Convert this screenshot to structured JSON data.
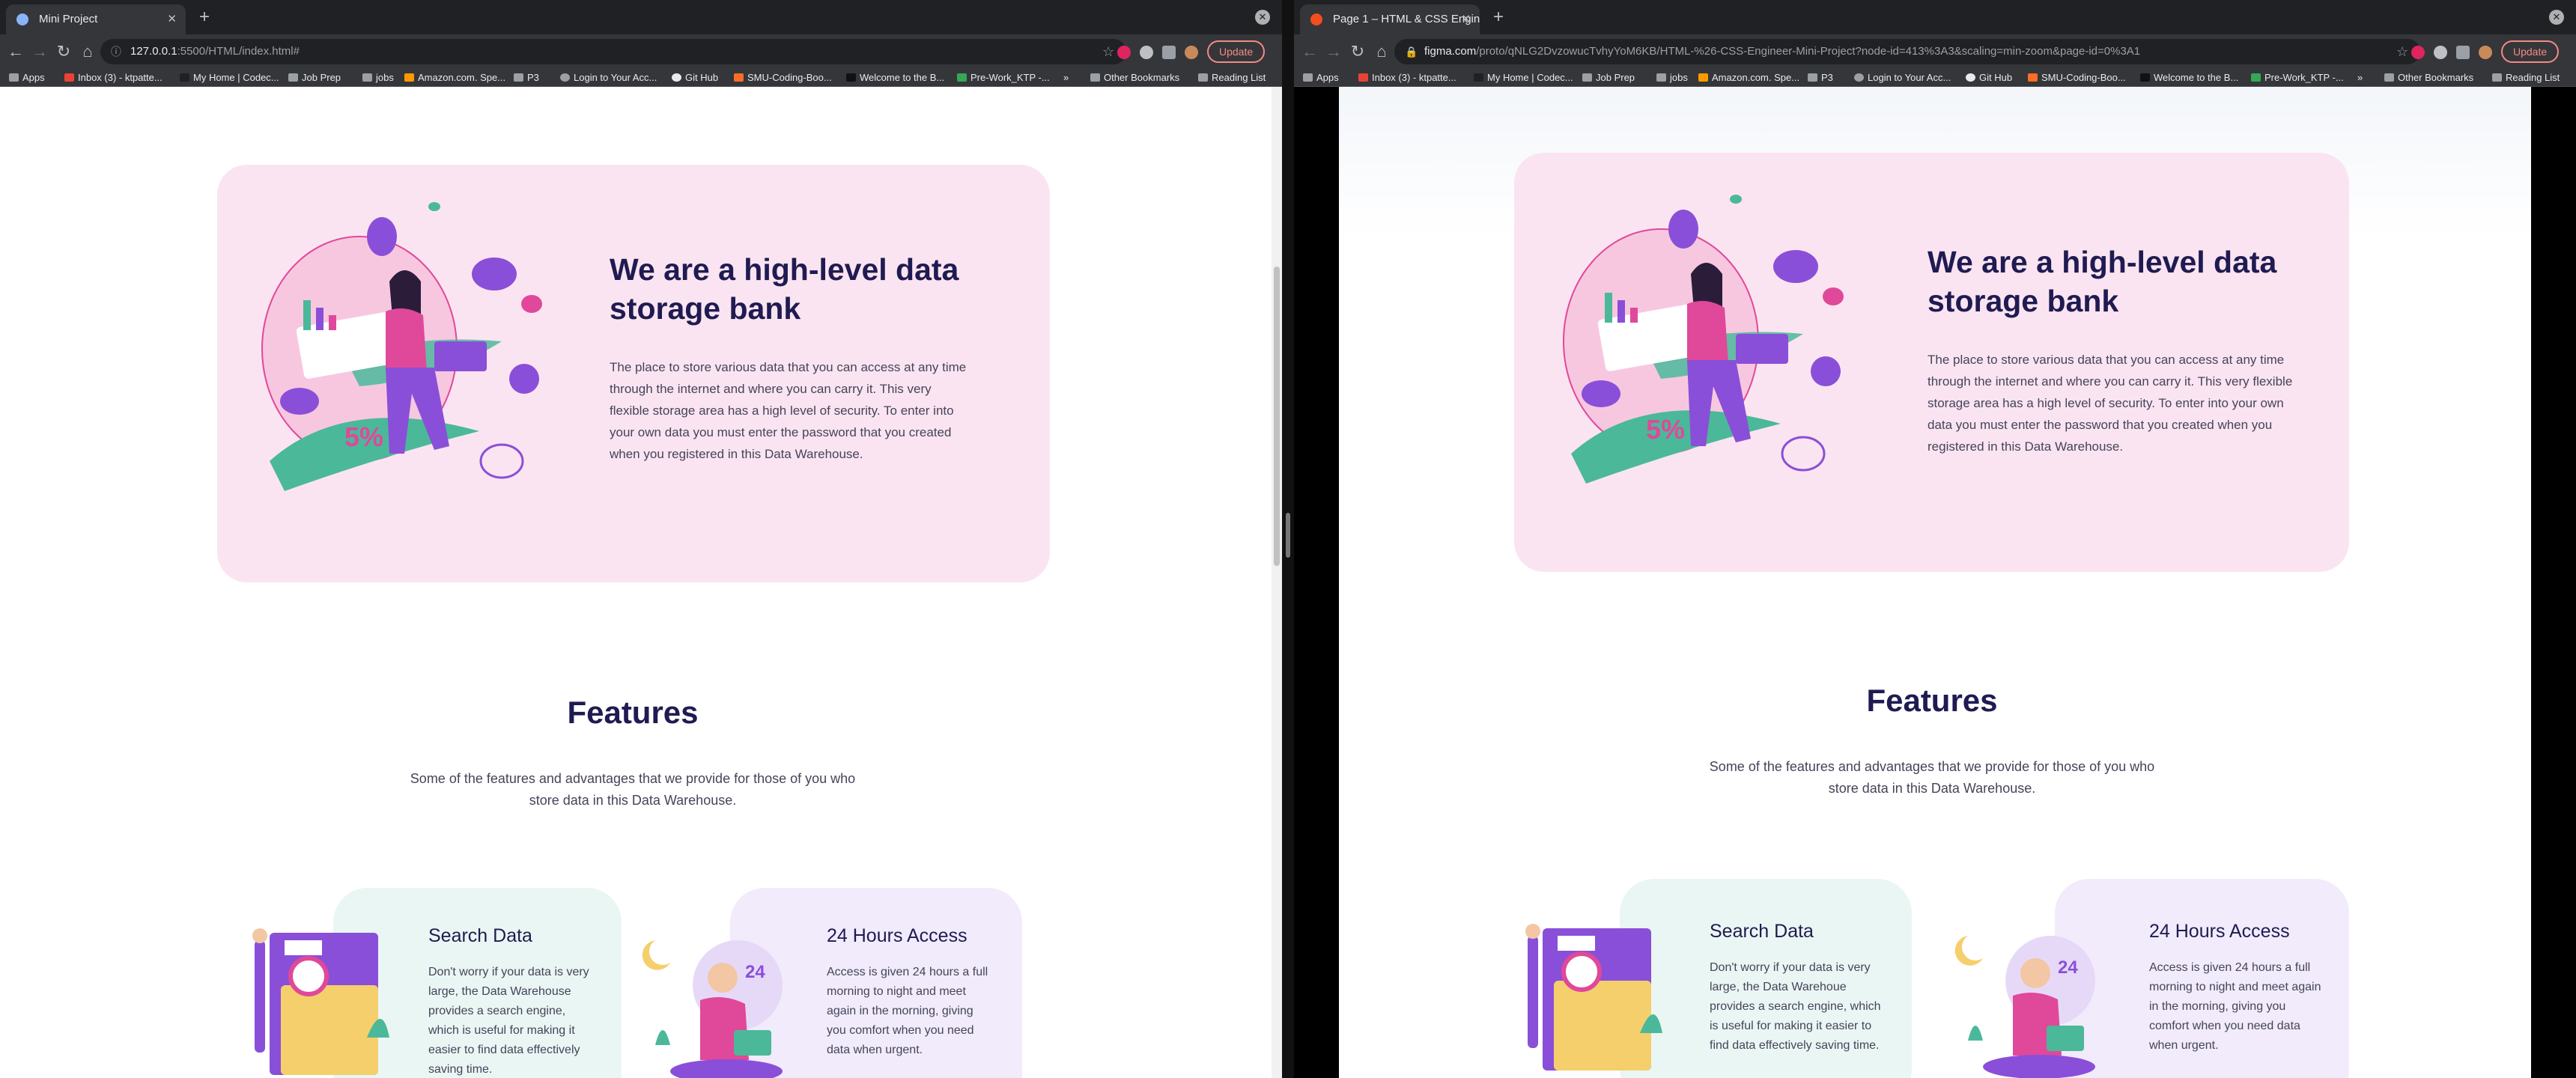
{
  "left_window": {
    "tab_title": "Mini Project",
    "url_host": "127.0.0.1",
    "url_rest": ":5500/HTML/index.html#",
    "update_label": "Update"
  },
  "right_window": {
    "tab_title": "Page 1 – HTML & CSS Engin...",
    "url_host": "figma.com",
    "url_rest": "/proto/qNLG2DvzowucTvhyYoM6KB/HTML-%26-CSS-Engineer-Mini-Project?node-id=413%3A3&scaling=min-zoom&page-id=0%3A1",
    "update_label": "Update"
  },
  "bookmarks": [
    "Apps",
    "Inbox (3) - ktpatte...",
    "My Home | Codec...",
    "Job Prep",
    "jobs",
    "Amazon.com. Spe...",
    "P3",
    "Login to Your Acc...",
    "Git Hub",
    "SMU-Coding-Boo...",
    "Welcome to the B...",
    "Pre-Work_KTP -..."
  ],
  "bookmarks_overflow": "»",
  "other_bookmarks": "Other Bookmarks",
  "reading_list": "Reading List",
  "page": {
    "hero_title": "We are a high-level data storage bank",
    "hero_text_left": "The place to store various data that you can access at any time through the internet and where you can carry it. This very flexible storage area has a high level of security. To enter into your own data you must enter the password that you created when you registered in this Data Warehouse.",
    "hero_text_right": "The place to store various data that you can access at any time through the internet  and where you can carry it. This very flexible storage area has a high level of security. To enter into your own data you must enter the password that you created when you registered in this Data Warehouse.",
    "features_title": "Features",
    "features_sub": "Some of the features and advantages that we provide for those of you who store data in this Data Warehouse.",
    "search_title": "Search Data",
    "search_text_left": "Don't worry if your data is very large, the Data Warehouse provides a search engine, which is useful for making it easier to find data effectively saving time.",
    "search_text_right": "Don't worry if your data is very large, the Data Warehoue provides a search engine, which is useful for making it easier to find data effectively saving time.",
    "access_title": "24 Hours Access",
    "access_text_left": "Access is given 24 hours a full morning to night and meet again in the morning, giving you comfort when you need data when urgent.",
    "access_text_right": "Access is given 24 hours a full morning to night and  meet again in the morning, giving you comfort when  you need data when urgent.",
    "badge_24": "24",
    "badge_5": "5%"
  },
  "colors": {
    "hero_bg": "#fbe4f1",
    "title": "#1f1b52",
    "card_green": "#eaf6f3",
    "card_purple": "#f1ebfb",
    "accent_pink": "#e0489a",
    "accent_purple": "#8a4fd8",
    "accent_teal": "#4bb89a"
  }
}
